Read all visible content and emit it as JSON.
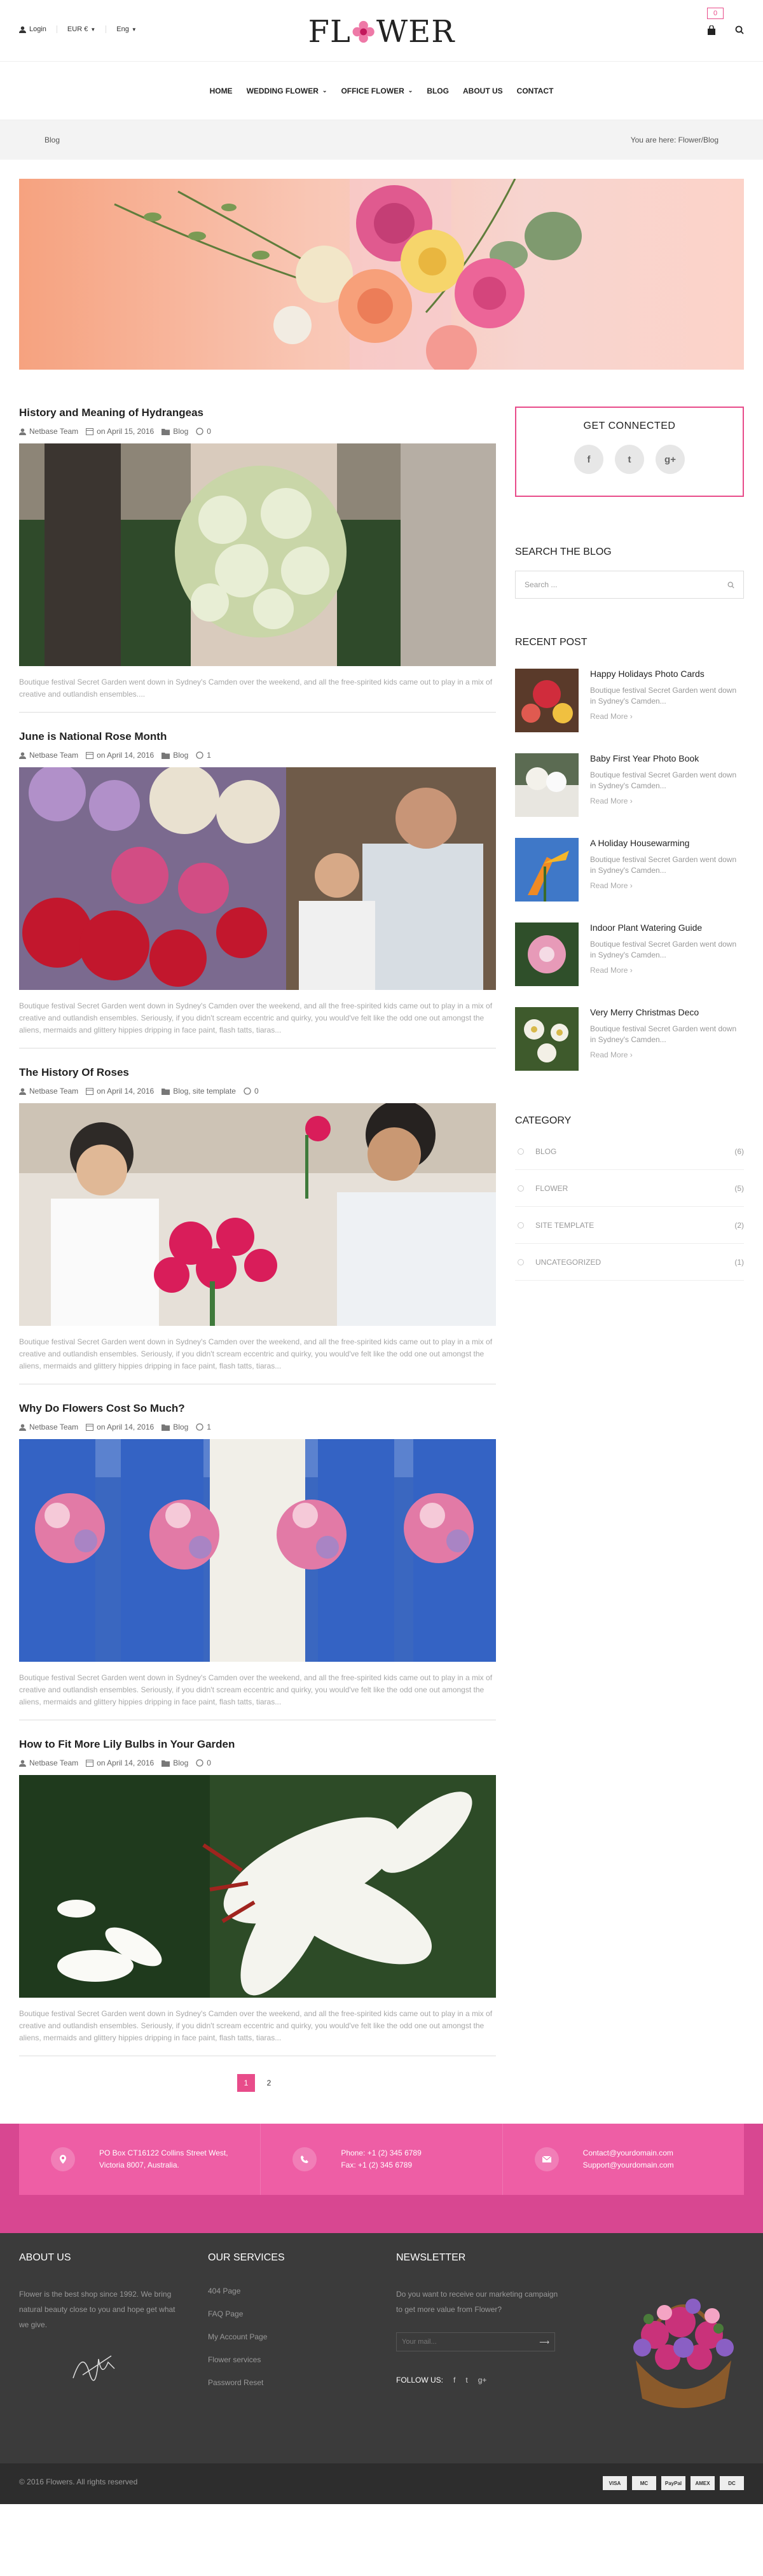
{
  "topbar": {
    "login": "Login",
    "currency": "EUR €",
    "language": "Eng",
    "logo": "FLOWER",
    "cart_count": "0"
  },
  "nav": {
    "items": [
      "HOME",
      "WEDDING FLOWER",
      "OFFICE FLOWER",
      "BLOG",
      "ABOUT US",
      "CONTACT"
    ]
  },
  "breadcrumb": {
    "title": "Blog",
    "trail": "You are here: Flower/Blog"
  },
  "posts": [
    {
      "title": "History and Meaning of Hydrangeas",
      "author": "Netbase Team",
      "date": "on April 15, 2016",
      "category": "Blog",
      "comments": "0",
      "excerpt": "Boutique festival Secret Garden went down in Sydney's Camden over the weekend, and all the free-spirited kids came out to play in a mix of creative and outlandish ensembles...."
    },
    {
      "title": "June is National Rose Month",
      "author": "Netbase Team",
      "date": "on April 14, 2016",
      "category": "Blog",
      "comments": "1",
      "excerpt": "Boutique festival Secret Garden went down in Sydney's Camden over the weekend, and all the free-spirited kids came out to play in a mix of creative and outlandish ensembles. Seriously, if you didn't scream eccentric and quirky, you would've felt like the odd one out amongst the aliens, mermaids and glittery hippies dripping in face paint, flash tatts, tiaras..."
    },
    {
      "title": "The History Of Roses",
      "author": "Netbase Team",
      "date": "on April 14, 2016",
      "category": "Blog, site template",
      "comments": "0",
      "excerpt": "Boutique festival Secret Garden went down in Sydney's Camden over the weekend, and all the free-spirited kids came out to play in a mix of creative and outlandish ensembles. Seriously, if you didn't scream eccentric and quirky, you would've felt like the odd one out amongst the aliens, mermaids and glittery hippies dripping in face paint, flash tatts, tiaras..."
    },
    {
      "title": "Why Do Flowers Cost So Much?",
      "author": "Netbase Team",
      "date": "on April 14, 2016",
      "category": "Blog",
      "comments": "1",
      "excerpt": "Boutique festival Secret Garden went down in Sydney's Camden over the weekend, and all the free-spirited kids came out to play in a mix of creative and outlandish ensembles. Seriously, if you didn't scream eccentric and quirky, you would've felt like the odd one out amongst the aliens, mermaids and glittery hippies dripping in face paint, flash tatts, tiaras..."
    },
    {
      "title": "How to Fit More Lily Bulbs in Your Garden",
      "author": "Netbase Team",
      "date": "on April 14, 2016",
      "category": "Blog",
      "comments": "0",
      "excerpt": "Boutique festival Secret Garden went down in Sydney's Camden over the weekend, and all the free-spirited kids came out to play in a mix of creative and outlandish ensembles. Seriously, if you didn't scream eccentric and quirky, you would've felt like the odd one out amongst the aliens, mermaids and glittery hippies dripping in face paint, flash tatts, tiaras..."
    }
  ],
  "pagination": {
    "current": "1",
    "next": "2"
  },
  "sidebar": {
    "connect_title": "GET CONNECTED",
    "socials": [
      "f",
      "t",
      "g+"
    ],
    "search_title": "SEARCH THE BLOG",
    "search_placeholder": "Search ...",
    "recent_title": "RECENT POST",
    "recent": [
      {
        "title": "Happy Holidays Photo Cards",
        "excerpt": "Boutique festival Secret Garden went down in Sydney's Camden...",
        "more": "Read More"
      },
      {
        "title": "Baby First Year Photo Book",
        "excerpt": "Boutique festival Secret Garden went down in Sydney's Camden...",
        "more": "Read More"
      },
      {
        "title": "A Holiday Housewarming",
        "excerpt": "Boutique festival Secret Garden went down in Sydney's Camden...",
        "more": "Read More"
      },
      {
        "title": "Indoor Plant Watering Guide",
        "excerpt": "Boutique festival Secret Garden went down in Sydney's Camden...",
        "more": "Read More"
      },
      {
        "title": "Very Merry Christmas Deco",
        "excerpt": "Boutique festival Secret Garden went down in Sydney's Camden...",
        "more": "Read More"
      }
    ],
    "category_title": "CATEGORY",
    "categories": [
      {
        "name": "BLOG",
        "count": "(6)"
      },
      {
        "name": "FLOWER",
        "count": "(5)"
      },
      {
        "name": "SITE TEMPLATE",
        "count": "(2)"
      },
      {
        "name": "UNCATEGORIZED",
        "count": "(1)"
      }
    ]
  },
  "contact": {
    "address_1": "PO Box CT16122 Collins Street West,",
    "address_2": "Victoria 8007, Australia.",
    "phone": "Phone: +1 (2) 345 6789",
    "fax": "Fax: +1 (2) 345 6789",
    "email_1": "Contact@yourdomain.com",
    "email_2": "Support@yourdomain.com"
  },
  "footer": {
    "about_title": "ABOUT US",
    "about_text": "Flower is the best shop since 1992. We bring natural beauty close to you and hope get what we give.",
    "services_title": "OUR SERVICES",
    "services": [
      "404 Page",
      "FAQ Page",
      "My Account Page",
      "Flower services",
      "Password Reset"
    ],
    "newsletter_title": "NEWSLETTER",
    "newsletter_text": "Do you want to receive our marketing campaign to get more value from Flower?",
    "newsletter_placeholder": "Your mail...",
    "follow": "FOLLOW US:",
    "copyright": "© 2016 Flowers. All rights reserved",
    "payments": [
      "VISA",
      "MC",
      "PayPal",
      "AMEX",
      "DC"
    ]
  },
  "colors": {
    "accent": "#e84c8a",
    "band": "#ee5ea5",
    "footer": "#3b3b3b"
  }
}
